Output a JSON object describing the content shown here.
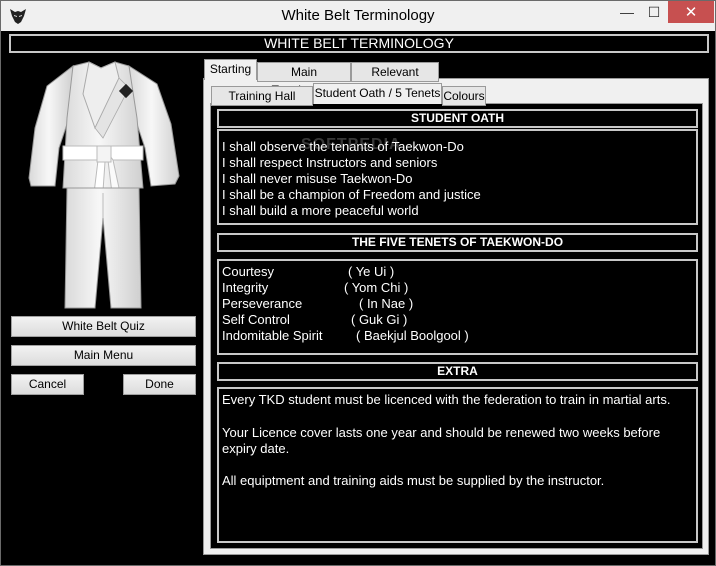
{
  "window": {
    "title": "White Belt Terminology",
    "minimize_glyph": "—",
    "maximize_glyph": "☐",
    "close_glyph": "✕"
  },
  "header": {
    "title": "WHITE BELT TERMINOLOGY"
  },
  "buttons": {
    "quiz": "White Belt Quiz",
    "main_menu": "Main Menu",
    "cancel": "Cancel",
    "done": "Done"
  },
  "outer_tabs": [
    "Starting",
    "Main Terminology",
    "Relevant Videos"
  ],
  "inner_tabs": [
    "Training Hall Rules",
    "Student Oath / 5 Tenets",
    "Colours"
  ],
  "oath": {
    "title": "STUDENT OATH",
    "lines": [
      "I shall observe the tenants of Taekwon-Do",
      "I shall respect Instructors and seniors",
      "I shall never misuse Taekwon-Do",
      "I shall be a champion of Freedom and justice",
      "I shall build a more peaceful world"
    ]
  },
  "tenets": {
    "title": "THE FIVE TENETS OF TAEKWON-DO",
    "items": [
      {
        "name": "Courtesy",
        "korean": "( Ye Ui )"
      },
      {
        "name": "Integrity",
        "korean": "( Yom Chi )"
      },
      {
        "name": "Perseverance",
        "korean": "( In Nae )"
      },
      {
        "name": "Self Control",
        "korean": "( Guk Gi )"
      },
      {
        "name": "Indomitable Spirit",
        "korean": "( Baekjul Boolgool )"
      }
    ]
  },
  "extra": {
    "title": "EXTRA",
    "lines": [
      "Every TKD student must be licenced with the federation to train in martial arts.",
      " Your Licence cover lasts one year and should be renewed two weeks before",
      "expiry date.",
      "All equiptment and training aids must be supplied by the instructor."
    ]
  },
  "watermark": "SOFTPEDIA",
  "colors": {
    "background": "#000000",
    "chrome": "#f0f0f0",
    "close": "#c75050",
    "belt": "#ffffff"
  },
  "icons": {
    "app": "taekwondo-mask-icon",
    "uniform": "dobok-uniform-image"
  }
}
